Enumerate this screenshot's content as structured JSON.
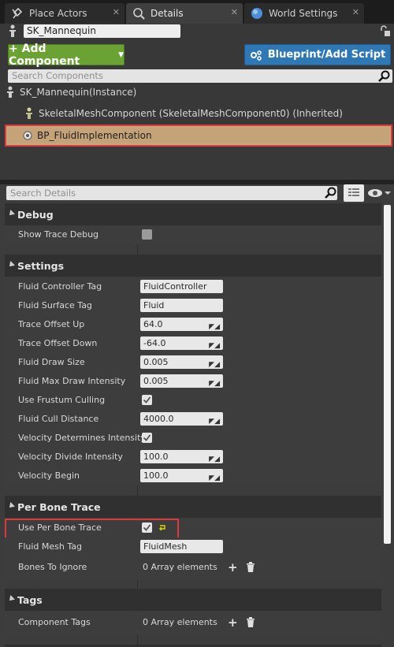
{
  "tabs": [
    {
      "label": "Place Actors",
      "icon": "place-actors-icon"
    },
    {
      "label": "Details",
      "icon": "details-icon"
    },
    {
      "label": "World Settings",
      "icon": "globe-icon"
    }
  ],
  "actor": {
    "name": "SK_Mannequin"
  },
  "toolbar": {
    "add_component_label": "+ Add Component",
    "blueprint_label": "Blueprint/Add Script"
  },
  "components_search": {
    "placeholder": "Search Components"
  },
  "component_tree": [
    {
      "label": "SK_Mannequin(Instance)"
    },
    {
      "label": "SkeletalMeshComponent (SkeletalMeshComponent0) (Inherited)"
    },
    {
      "label": "BP_FluidImplementation",
      "selected": true
    }
  ],
  "details_search": {
    "placeholder": "Search Details"
  },
  "categories": {
    "debug": "Debug",
    "settings": "Settings",
    "per_bone": "Per Bone Trace",
    "tags": "Tags"
  },
  "properties": {
    "show_trace_debug": {
      "label": "Show Trace Debug",
      "checked": false
    },
    "fluid_controller_tag": {
      "label": "Fluid Controller Tag",
      "value": "FluidController"
    },
    "fluid_surface_tag": {
      "label": "Fluid Surface Tag",
      "value": "Fluid"
    },
    "trace_offset_up": {
      "label": "Trace Offset Up",
      "value": "64.0"
    },
    "trace_offset_down": {
      "label": "Trace Offset Down",
      "value": "-64.0"
    },
    "fluid_draw_size": {
      "label": "Fluid Draw Size",
      "value": "0.005"
    },
    "fluid_max_draw_intensity": {
      "label": "Fluid Max Draw Intensity",
      "value": "0.005"
    },
    "use_frustum_culling": {
      "label": "Use Frustum Culling",
      "checked": true
    },
    "fluid_cull_distance": {
      "label": "Fluid Cull Distance",
      "value": "4000.0"
    },
    "velocity_determines_intensity": {
      "label": "Velocity Determines Intensity",
      "checked": true
    },
    "velocity_divide_intensity": {
      "label": "Velocity Divide Intensity",
      "value": "100.0"
    },
    "velocity_begin": {
      "label": "Velocity Begin",
      "value": "100.0"
    },
    "use_per_bone_trace": {
      "label": "Use Per Bone Trace",
      "checked": true
    },
    "fluid_mesh_tag": {
      "label": "Fluid Mesh Tag",
      "value": "FluidMesh"
    },
    "bones_to_ignore": {
      "label": "Bones To Ignore",
      "value": "0 Array elements"
    },
    "component_tags": {
      "label": "Component Tags",
      "value": "0 Array elements"
    }
  },
  "colors": {
    "add_button": "#6aa234",
    "blueprint_button": "#2f78b6",
    "selection": "#c9a77d",
    "highlight": "#d83b3b"
  }
}
